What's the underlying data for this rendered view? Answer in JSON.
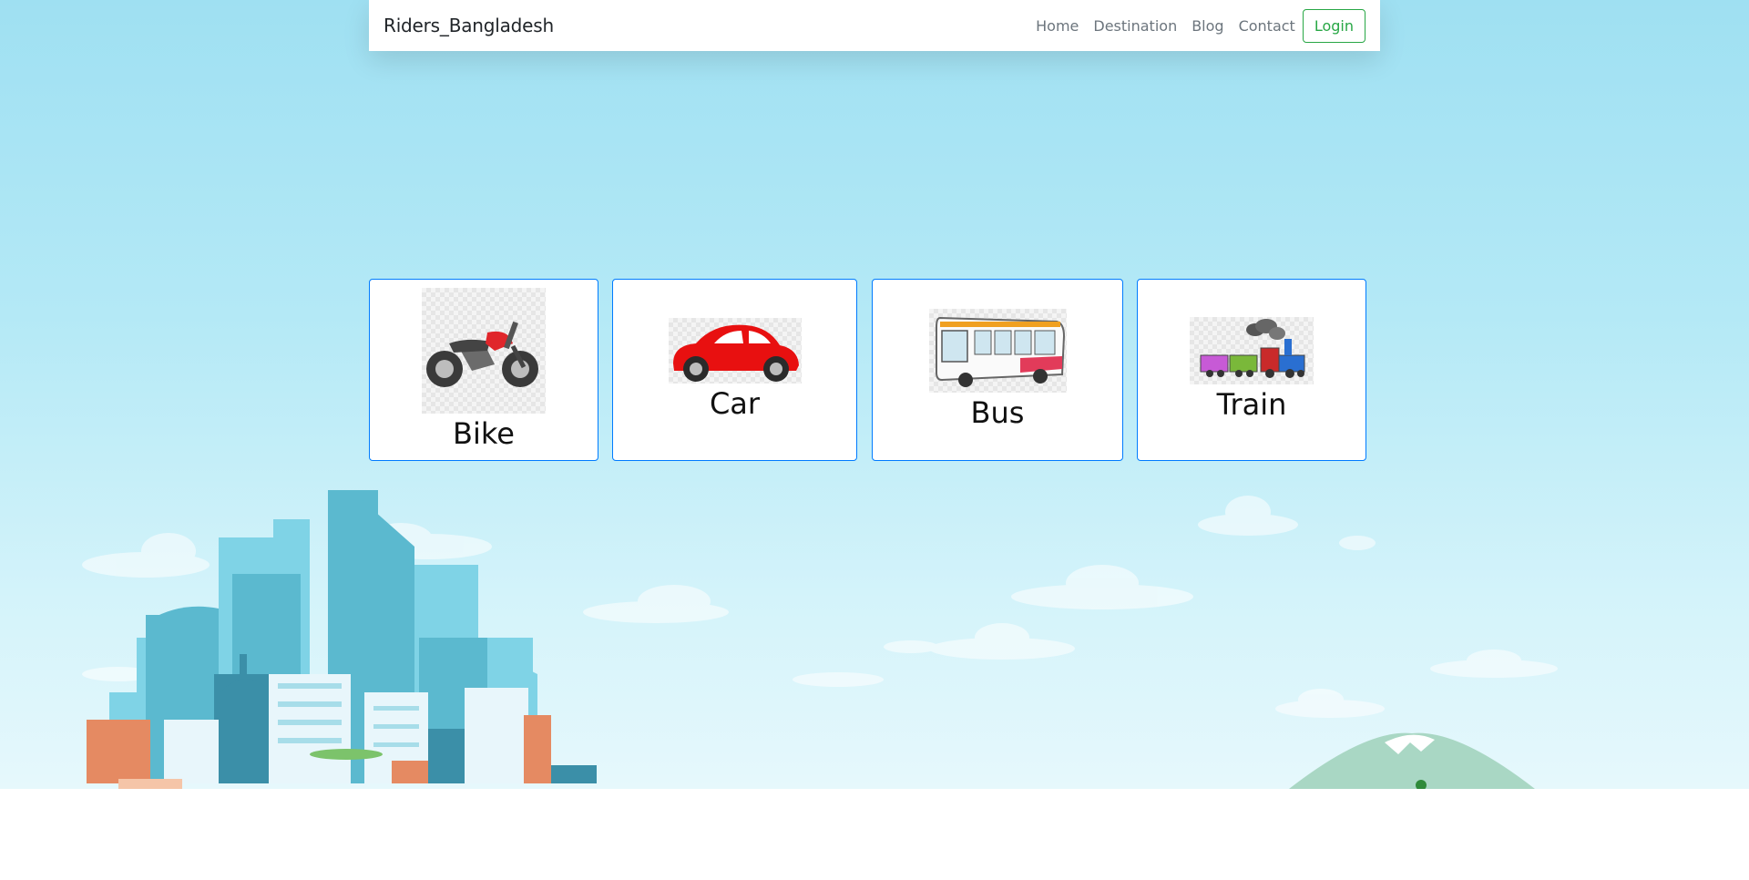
{
  "navbar": {
    "brand": "Riders_Bangladesh",
    "links": [
      "Home",
      "Destination",
      "Blog",
      "Contact"
    ],
    "login_label": "Login"
  },
  "vehicles": [
    {
      "label": "Bike",
      "icon": "motorcycle-icon"
    },
    {
      "label": "Car",
      "icon": "car-icon"
    },
    {
      "label": "Bus",
      "icon": "bus-icon"
    },
    {
      "label": "Train",
      "icon": "train-icon"
    }
  ],
  "colors": {
    "card_border": "#007bff",
    "login_accent": "#28a745",
    "sky": "#a8e4f4"
  }
}
